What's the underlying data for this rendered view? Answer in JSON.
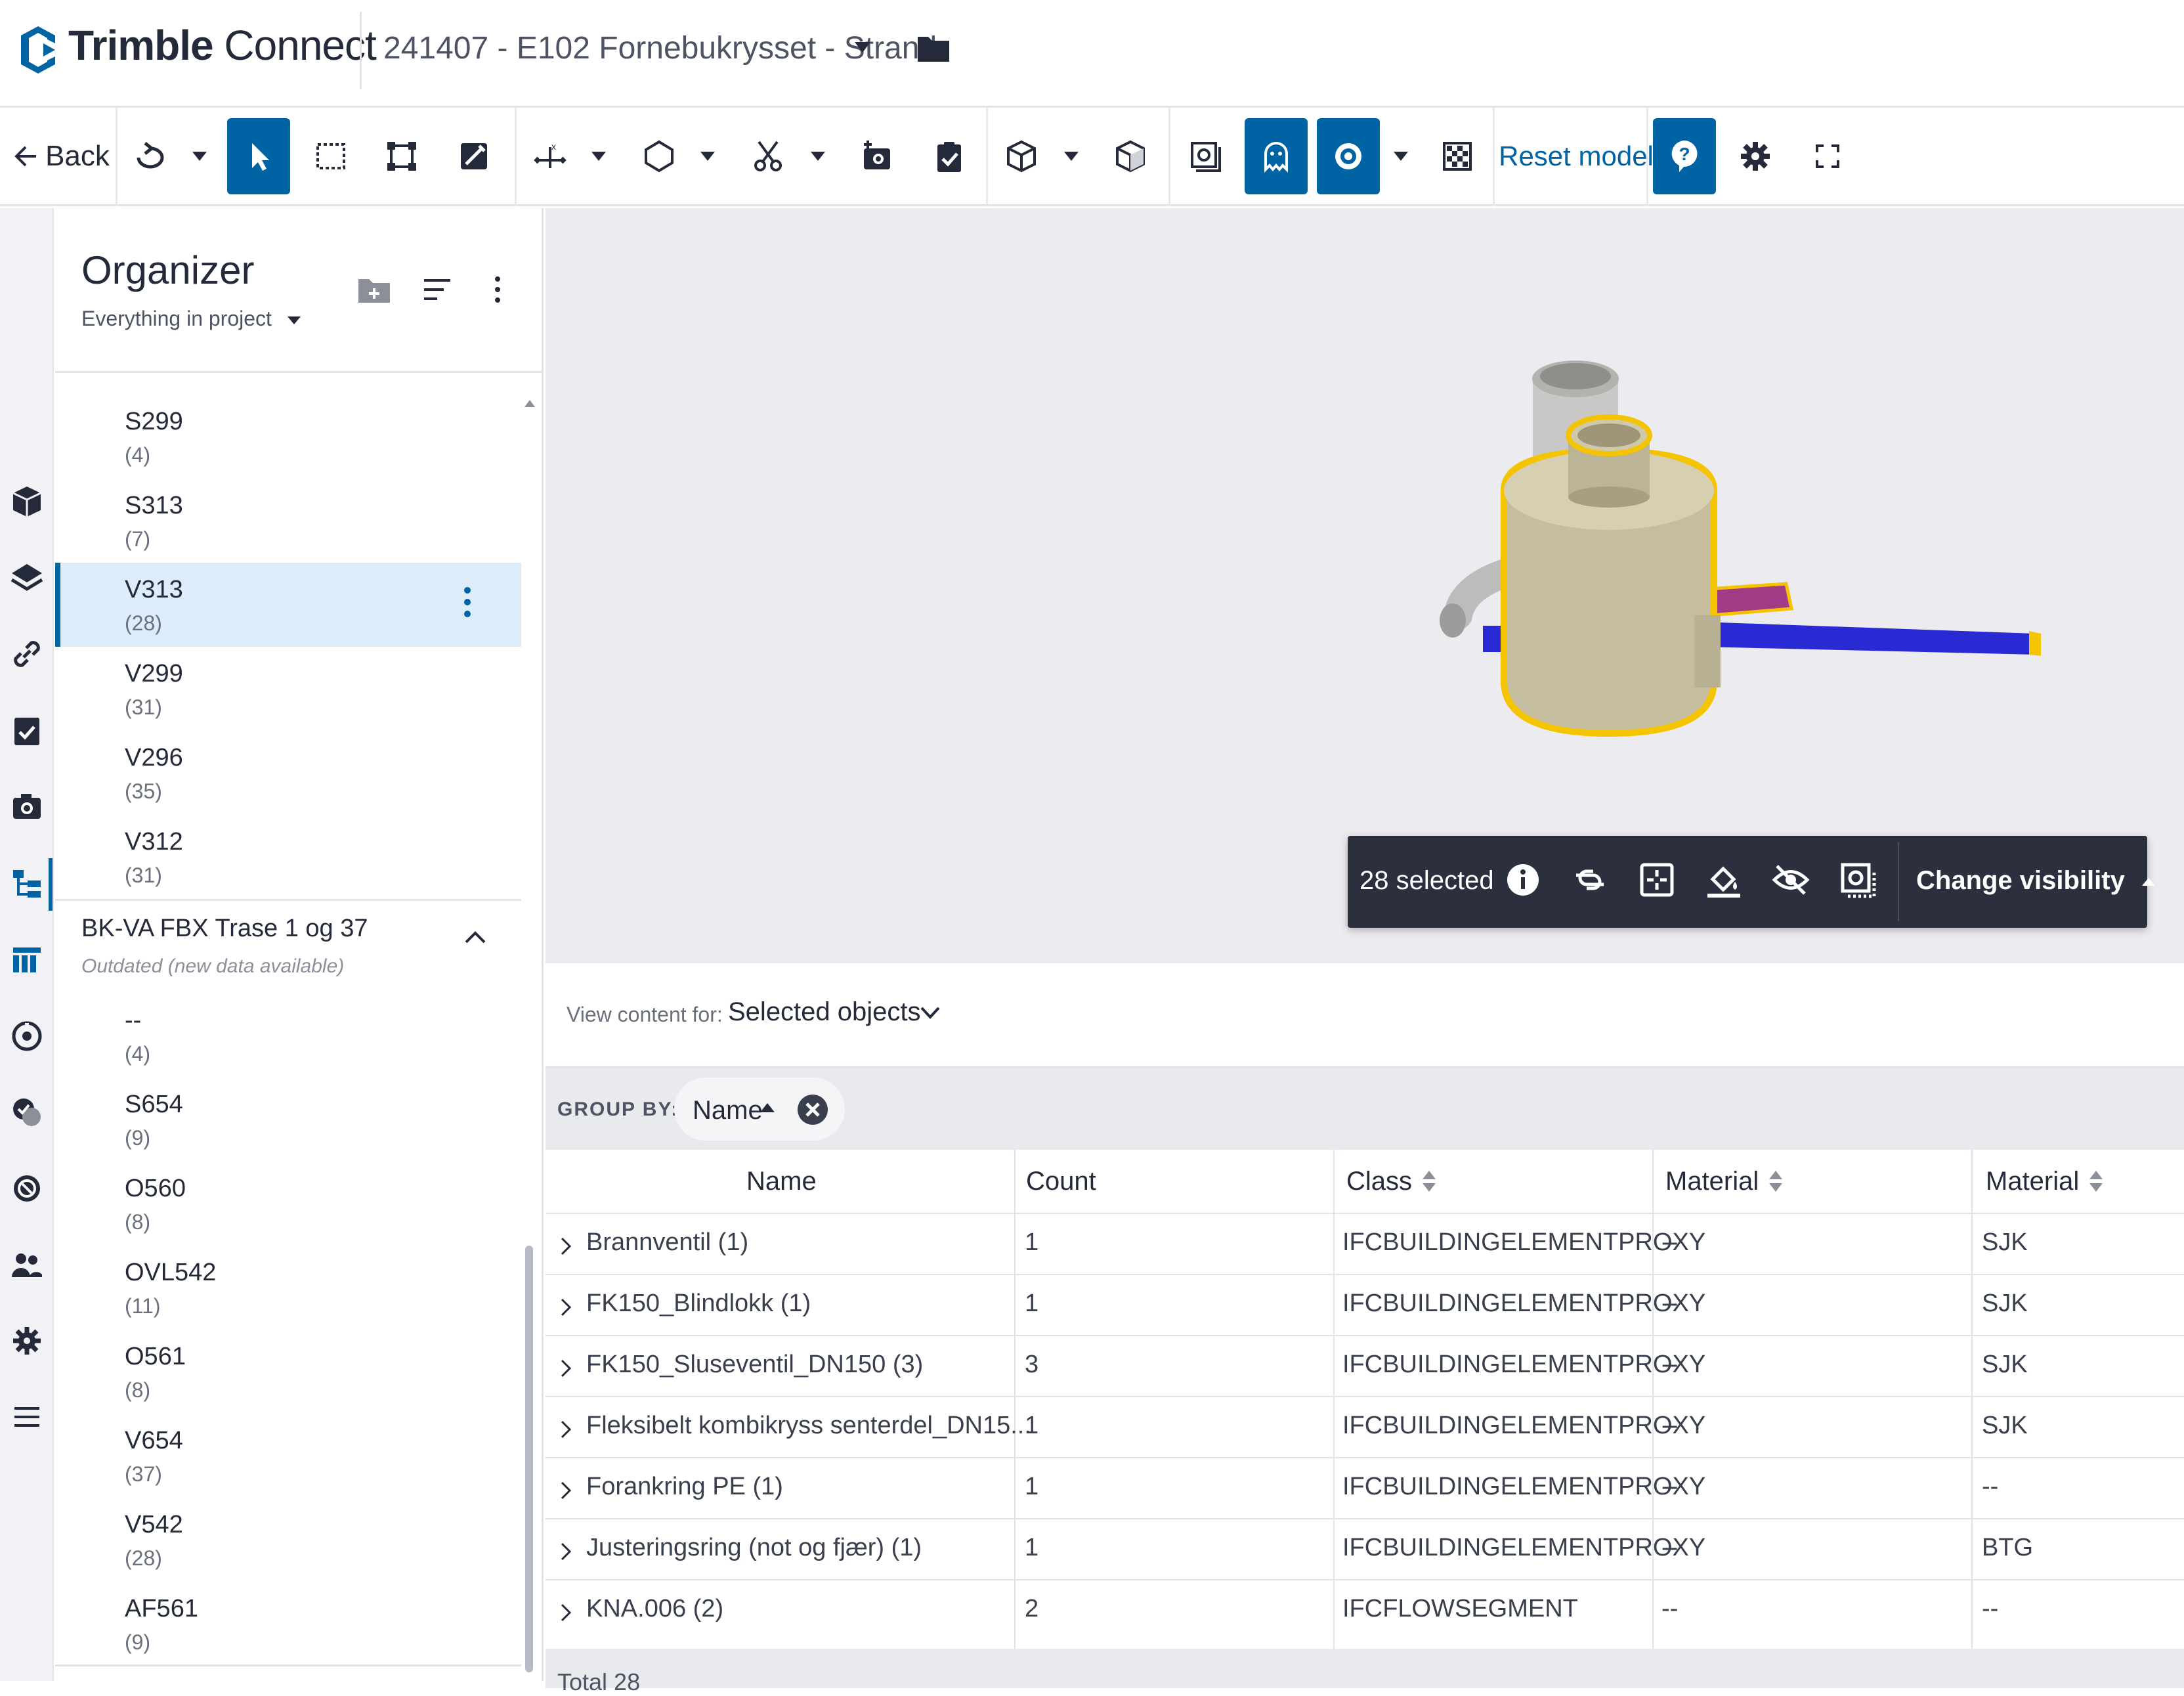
{
  "app": {
    "brand_bold": "Trimble",
    "brand_light": " Connect",
    "project": "241407 - E102 Fornebukrysset - Strand"
  },
  "toolbar": {
    "back_label": "Back",
    "reset_label": "Reset model"
  },
  "organizer": {
    "title": "Organizer",
    "scope": "Everything in project",
    "items": [
      {
        "name": "S299",
        "count": "(4)"
      },
      {
        "name": "S313",
        "count": "(7)"
      },
      {
        "name": "V313",
        "count": "(28)"
      },
      {
        "name": "V299",
        "count": "(31)"
      },
      {
        "name": "V296",
        "count": "(35)"
      },
      {
        "name": "V312",
        "count": "(31)"
      }
    ],
    "group": {
      "title": "BK-VA FBX Trase 1 og 37",
      "subtitle": "Outdated (new data available)",
      "items": [
        {
          "name": "--",
          "count": "(4)"
        },
        {
          "name": "S654",
          "count": "(9)"
        },
        {
          "name": "O560",
          "count": "(8)"
        },
        {
          "name": "OVL542",
          "count": "(11)"
        },
        {
          "name": "O561",
          "count": "(8)"
        },
        {
          "name": "V654",
          "count": "(37)"
        },
        {
          "name": "V542",
          "count": "(28)"
        },
        {
          "name": "AF561",
          "count": "(9)"
        }
      ]
    }
  },
  "selection": {
    "count_label": "28 selected",
    "visibility_label": "Change visibility"
  },
  "view_content": {
    "label": "View content for:",
    "value": "Selected objects"
  },
  "group_by": {
    "label": "GROUP BY:",
    "chip": "Name"
  },
  "table": {
    "headers": [
      "Name",
      "Count",
      "Class",
      "Material",
      "Material"
    ],
    "rows": [
      [
        "Brannventil (1)",
        "1",
        "IFCBUILDINGELEMENTPROXY",
        "--",
        "SJK"
      ],
      [
        "FK150_Blindlokk (1)",
        "1",
        "IFCBUILDINGELEMENTPROXY",
        "--",
        "SJK"
      ],
      [
        "FK150_Sluseventil_DN150 (3)",
        "3",
        "IFCBUILDINGELEMENTPROXY",
        "--",
        "SJK"
      ],
      [
        "Fleksibelt kombikryss senterdel_DN15...",
        "1",
        "IFCBUILDINGELEMENTPROXY",
        "--",
        "SJK"
      ],
      [
        "Forankring PE (1)",
        "1",
        "IFCBUILDINGELEMENTPROXY",
        "--",
        "--"
      ],
      [
        "Justeringsring (not og fjær) (1)",
        "1",
        "IFCBUILDINGELEMENTPROXY",
        "--",
        "BTG"
      ],
      [
        "KNA.006 (2)",
        "2",
        "IFCFLOWSEGMENT",
        "--",
        "--"
      ]
    ],
    "total": "Total 28"
  },
  "colors": {
    "accent": "#0063a3",
    "selected_row": "#dcecf8",
    "selection_bar": "#2b2f3e",
    "viewer_bg": "#ececf0",
    "highlight": "#f5c400"
  }
}
